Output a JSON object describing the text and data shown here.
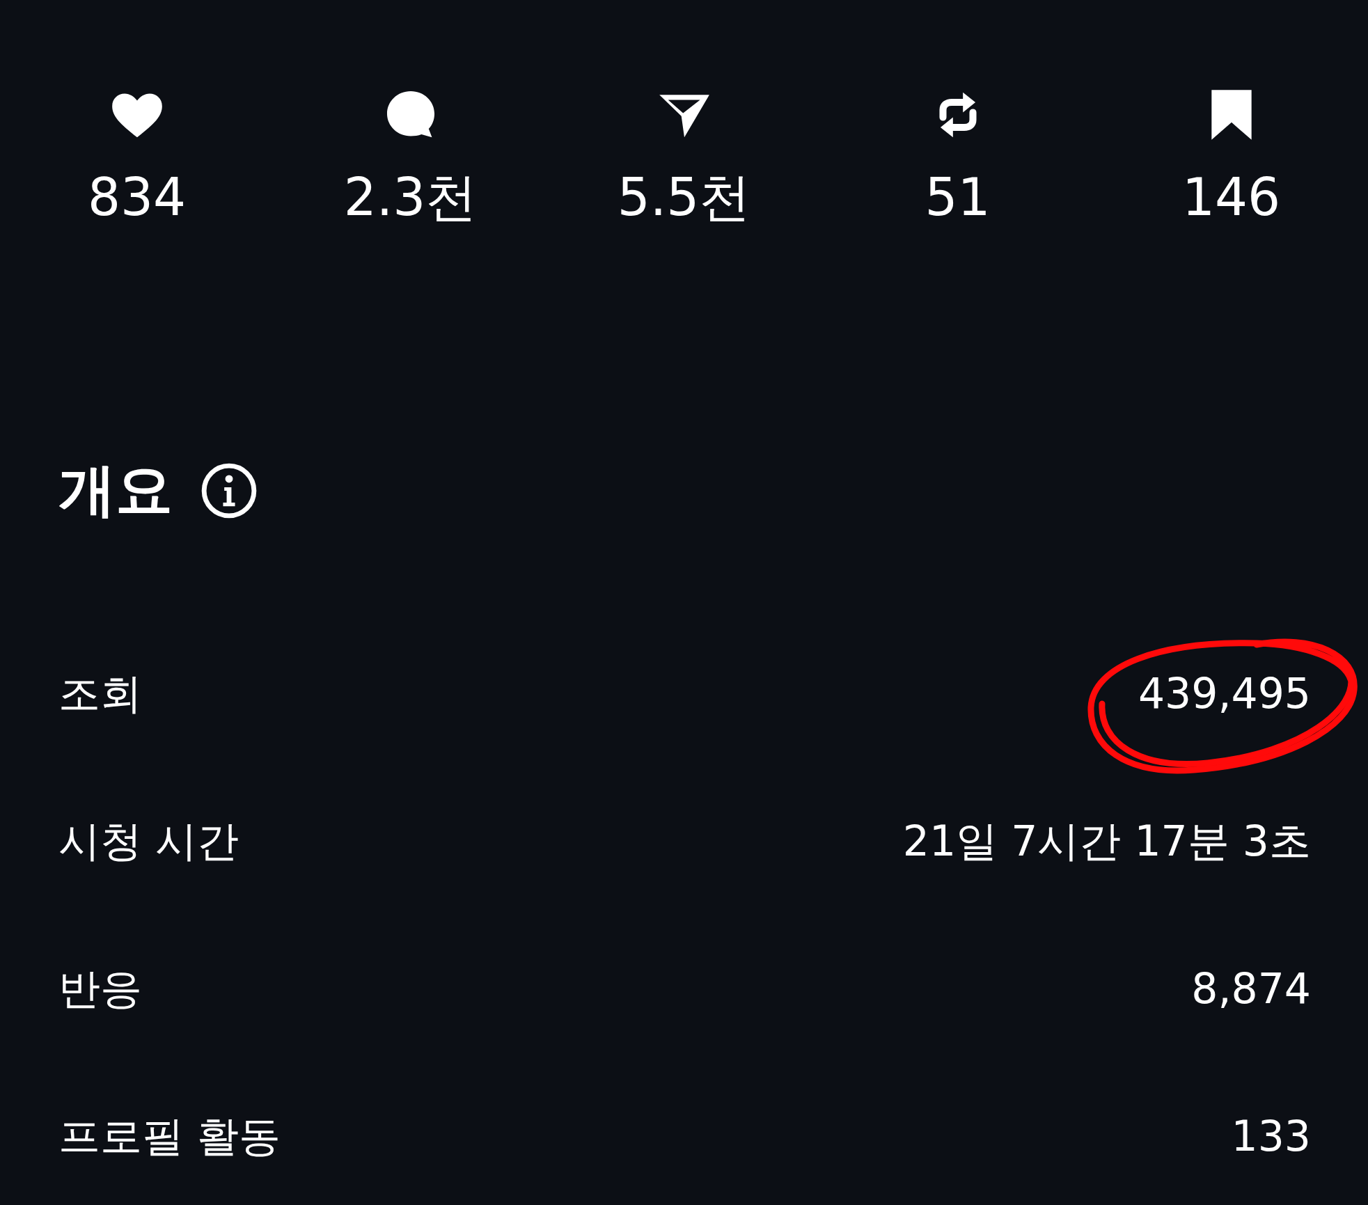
{
  "stats": [
    {
      "kind": "likes",
      "value": "834"
    },
    {
      "kind": "comments",
      "value": "2.3천"
    },
    {
      "kind": "shares",
      "value": "5.5천"
    },
    {
      "kind": "reposts",
      "value": "51"
    },
    {
      "kind": "saves",
      "value": "146"
    }
  ],
  "overview": {
    "title": "개요",
    "rows": [
      {
        "label": "조회",
        "value": "439,495",
        "highlighted": true
      },
      {
        "label": "시청 시간",
        "value": "21일 7시간 17분 3초",
        "highlighted": false
      },
      {
        "label": "반응",
        "value": "8,874",
        "highlighted": false
      },
      {
        "label": "프로필 활동",
        "value": "133",
        "highlighted": false
      }
    ]
  }
}
